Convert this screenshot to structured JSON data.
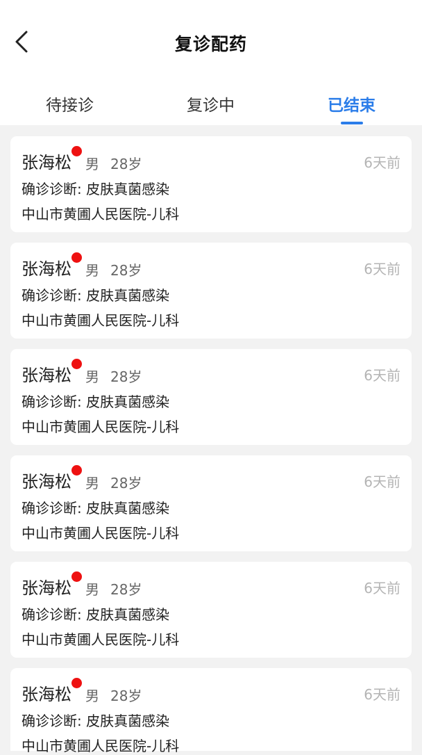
{
  "header": {
    "title": "复诊配药",
    "back_icon": "chevron-left-icon"
  },
  "tabs": [
    {
      "label": "待接诊",
      "active": false
    },
    {
      "label": "复诊中",
      "active": false
    },
    {
      "label": "已结束",
      "active": true
    }
  ],
  "colors": {
    "accent": "#2b7de9",
    "unread_dot": "#ee1111",
    "page_background": "#f2f2f2"
  },
  "records": [
    {
      "name": "张海松",
      "gender": "男",
      "age": "28岁",
      "time": "6天前",
      "diagnosis_label": "确诊诊断:",
      "diagnosis": "皮肤真菌感染",
      "hospital": "中山市黄圃人民医院-儿科",
      "unread": true
    },
    {
      "name": "张海松",
      "gender": "男",
      "age": "28岁",
      "time": "6天前",
      "diagnosis_label": "确诊诊断:",
      "diagnosis": "皮肤真菌感染",
      "hospital": "中山市黄圃人民医院-儿科",
      "unread": true
    },
    {
      "name": "张海松",
      "gender": "男",
      "age": "28岁",
      "time": "6天前",
      "diagnosis_label": "确诊诊断:",
      "diagnosis": "皮肤真菌感染",
      "hospital": "中山市黄圃人民医院-儿科",
      "unread": true
    },
    {
      "name": "张海松",
      "gender": "男",
      "age": "28岁",
      "time": "6天前",
      "diagnosis_label": "确诊诊断:",
      "diagnosis": "皮肤真菌感染",
      "hospital": "中山市黄圃人民医院-儿科",
      "unread": true
    },
    {
      "name": "张海松",
      "gender": "男",
      "age": "28岁",
      "time": "6天前",
      "diagnosis_label": "确诊诊断:",
      "diagnosis": "皮肤真菌感染",
      "hospital": "中山市黄圃人民医院-儿科",
      "unread": true
    },
    {
      "name": "张海松",
      "gender": "男",
      "age": "28岁",
      "time": "6天前",
      "diagnosis_label": "确诊诊断:",
      "diagnosis": "皮肤真菌感染",
      "hospital": "中山市黄圃人民医院-儿科",
      "unread": true
    }
  ]
}
